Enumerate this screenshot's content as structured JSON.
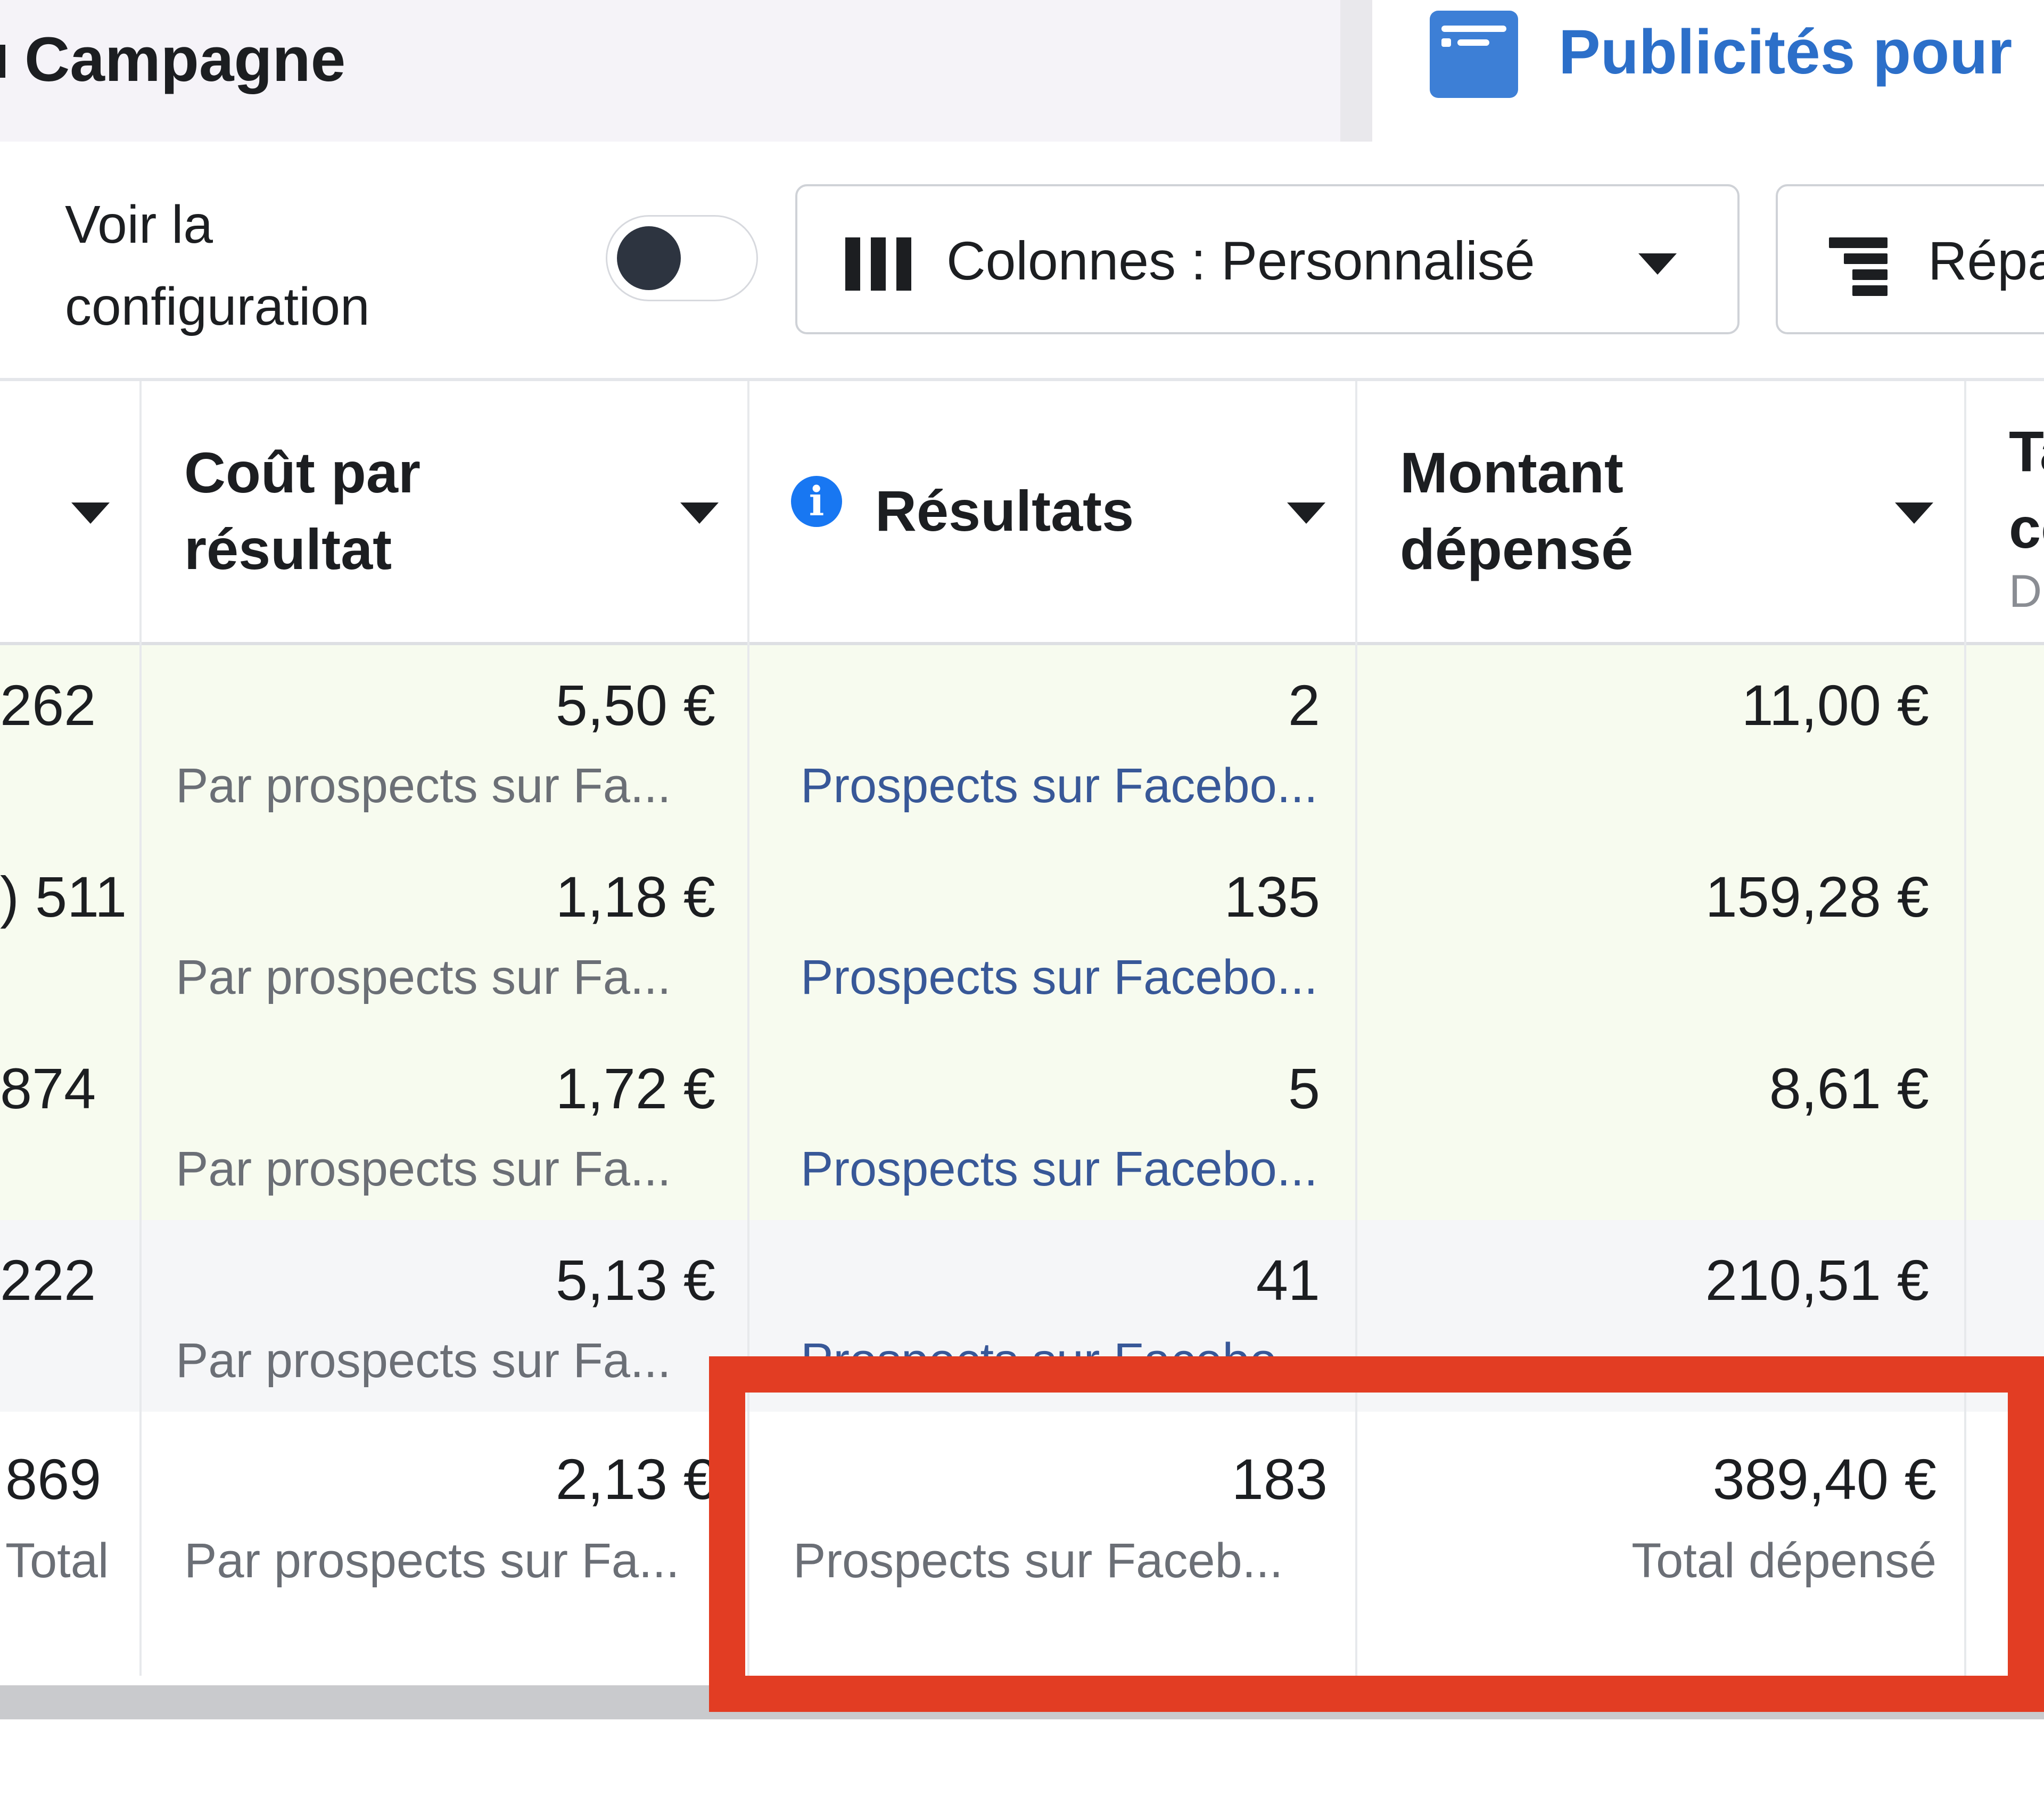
{
  "tabs": {
    "campaign": {
      "label": "Campagne"
    },
    "ads": {
      "label": "Publicités pour",
      "icon": "ad-window-icon"
    }
  },
  "toolbar": {
    "config_label_line1": "Voir la",
    "config_label_line2": "configuration",
    "config_toggle_on": false,
    "columns_button_label": "Colonnes : Personnalisé",
    "breakdown_button_label": "Répa"
  },
  "table": {
    "headers": [
      {
        "key": "cut",
        "label": ""
      },
      {
        "key": "cost_per_result",
        "label_line1": "Coût par",
        "label_line2": "résultat"
      },
      {
        "key": "results",
        "label": "Résultats",
        "info_icon": true
      },
      {
        "key": "amount_spent",
        "label_line1": "Montant",
        "label_line2": "dépensé"
      },
      {
        "key": "next",
        "label_line1": "Ta",
        "label_line2": "co",
        "label_line3": "D"
      }
    ],
    "rows": [
      {
        "cut": "262",
        "cost": "5,50 €",
        "cost_sub": "Par prospects sur Fa...",
        "results": "2",
        "results_sub": "Prospects sur Facebo...",
        "spent": "11,00 €"
      },
      {
        "cut": ") 511",
        "cost": "1,18 €",
        "cost_sub": "Par prospects sur Fa...",
        "results": "135",
        "results_sub": "Prospects sur Facebo...",
        "spent": "159,28 €"
      },
      {
        "cut": "874",
        "cost": "1,72 €",
        "cost_sub": "Par prospects sur Fa...",
        "results": "5",
        "results_sub": "Prospects sur Facebo...",
        "spent": "8,61 €"
      },
      {
        "cut": "222",
        "cost": "5,13 €",
        "cost_sub": "Par prospects sur Fa...",
        "results": "41",
        "results_sub": "Prospects sur Facebo...",
        "spent": "210,51 €"
      }
    ],
    "total": {
      "cut": "869",
      "cut_sub": "Total",
      "cost": "2,13 €",
      "cost_sub": "Par prospects sur Fa...",
      "results": "183",
      "results_sub": "Prospects sur Faceb...",
      "spent": "389,40 €",
      "spent_sub": "Total dépensé"
    }
  },
  "colors": {
    "accent_blue": "#1877f2",
    "tab_link_blue": "#2c6fc9",
    "highlight_red": "#e23d23",
    "row_green": "#f7fbef"
  }
}
